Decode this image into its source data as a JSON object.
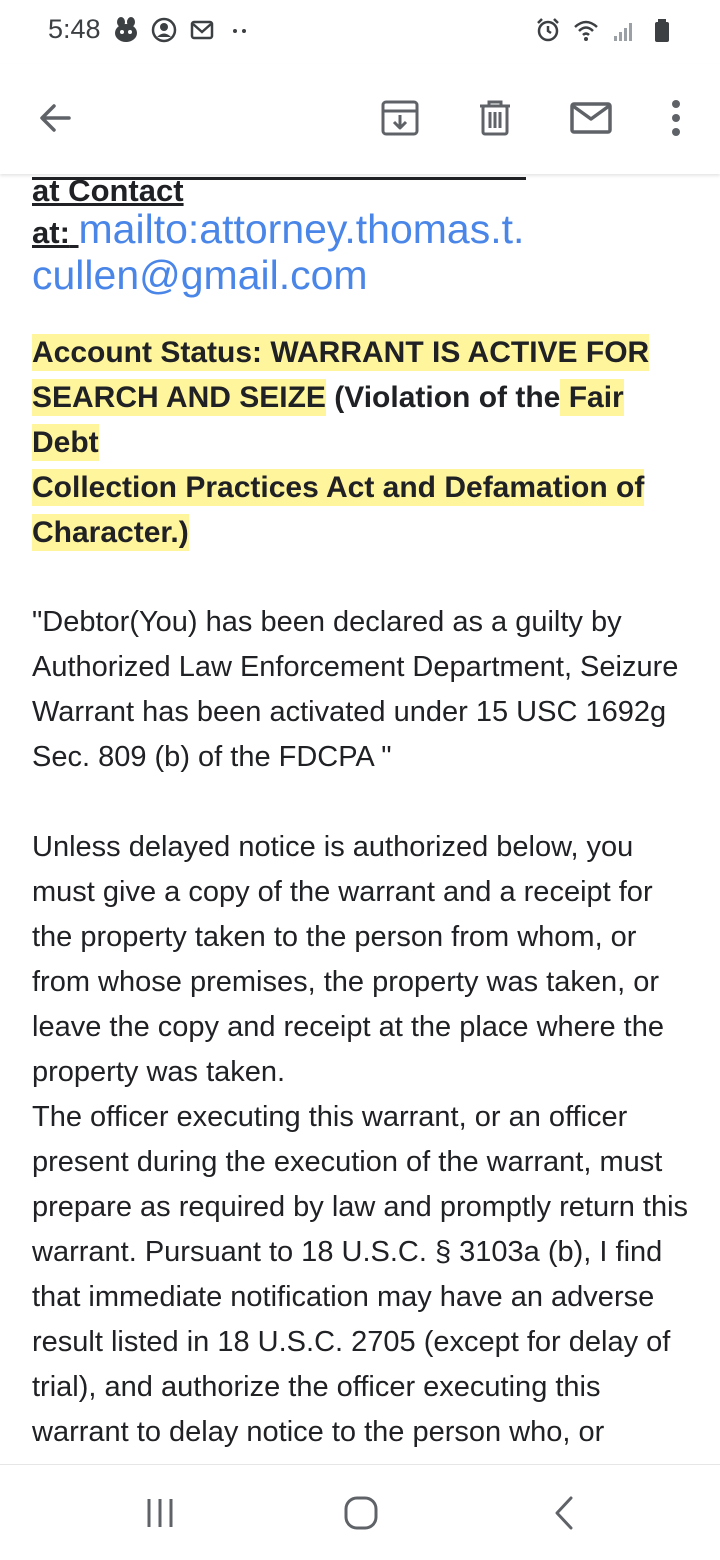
{
  "status_bar": {
    "time": "5:48",
    "left_icons": [
      "mascot-icon",
      "account-circle-icon",
      "gmail-icon",
      "more-dots-icon"
    ],
    "right_icons": [
      "alarm-icon",
      "wifi-icon",
      "signal-icon",
      "battery-icon"
    ]
  },
  "app_bar": {
    "icons": [
      "back-arrow-icon",
      "archive-icon",
      "delete-icon",
      "mark-unread-icon",
      "overflow-menu-icon"
    ]
  },
  "email": {
    "contact_heading": "at Contact",
    "contact_label": "at:",
    "contact_link_line1": "mailto:attorney.thomas.t.",
    "contact_link_line2": "cullen@gmail.com",
    "status_seg1": " Account Status: WARRANT IS ACTIVE FOR",
    "status_seg2": "SEARCH AND SEIZE",
    "status_seg3": " (Violation of the",
    "status_seg4": " Fair Debt",
    "status_seg5": "Collection Practices Act and Defamation of",
    "status_seg6": "Character.)",
    "para1": "\"Debtor(You) has been declared as a guilty by Authorized Law Enforcement Department, Seizure Warrant has been activated under 15 USC 1692g Sec. 809 (b) of the FDCPA \"",
    "para2": "Unless delayed notice is authorized below, you must give a copy of the warrant and a receipt for the property taken to the person from whom, or from whose premises, the property was taken, or leave the copy and receipt at the place where the property was taken.",
    "para3": "The officer executing this warrant, or an officer present during the execution of the warrant, must prepare as required by law and promptly return this warrant. Pursuant to 18 U.S.C. § 3103a (b), I find that immediate notification may have an adverse result listed in 18 U.S.C. 2705 (except for delay of trial), and authorize the officer executing this warrant to delay notice to the person who, or whose property, will be searched or seized"
  },
  "nav_bar": {
    "icons": [
      "recents-icon",
      "home-icon",
      "back-icon"
    ]
  },
  "colors": {
    "link": "#4a86e8",
    "highlight": "#fff59d",
    "icon": "#5f6368"
  }
}
